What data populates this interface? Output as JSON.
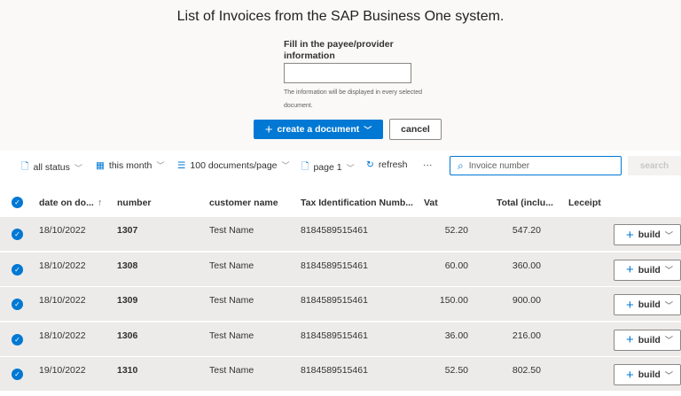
{
  "title": "List of Invoices from the SAP Business One system.",
  "form": {
    "label": "Fill in the payee/provider information",
    "value": "",
    "hint": "The information will be displayed in every selected document.",
    "create_label": "create a document",
    "cancel_label": "cancel"
  },
  "toolbar": {
    "status": "all status",
    "period": "this month",
    "page_size": "100 documents/page",
    "page": "page 1",
    "refresh": "refresh",
    "more": "···",
    "search_placeholder": "Invoice number",
    "search_label": "search"
  },
  "columns": [
    "date on do...",
    "number",
    "customer name",
    "Tax Identification Numb...",
    "Vat",
    "Total (inclu...",
    "Leceipt"
  ],
  "sort_indicator": "↑",
  "row_action": "build",
  "rows": [
    {
      "date": "18/10/2022",
      "number": "1307",
      "customer": "Test Name",
      "tax_id": "8184589515461",
      "vat": "52.20",
      "total": "547.20"
    },
    {
      "date": "18/10/2022",
      "number": "1308",
      "customer": "Test Name",
      "tax_id": "8184589515461",
      "vat": "60.00",
      "total": "360.00"
    },
    {
      "date": "18/10/2022",
      "number": "1309",
      "customer": "Test Name",
      "tax_id": "8184589515461",
      "vat": "150.00",
      "total": "900.00"
    },
    {
      "date": "18/10/2022",
      "number": "1306",
      "customer": "Test Name",
      "tax_id": "8184589515461",
      "vat": "36.00",
      "total": "216.00"
    },
    {
      "date": "19/10/2022",
      "number": "1310",
      "customer": "Test Name",
      "tax_id": "8184589515461",
      "vat": "52.50",
      "total": "802.50"
    }
  ]
}
